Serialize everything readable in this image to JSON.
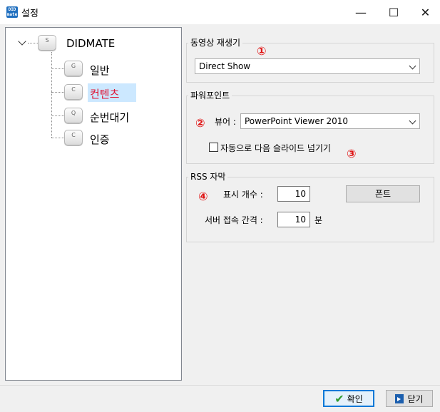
{
  "window": {
    "title": "설정",
    "app_icon_text": "DID mate",
    "minimize_glyph": "—",
    "maximize_glyph": "☐",
    "close_glyph": "✕"
  },
  "tree": {
    "root": {
      "label": "DIDMATE",
      "key": "S",
      "expanded": true
    },
    "children": [
      {
        "label": "일반",
        "key": "G",
        "selected": false
      },
      {
        "label": "컨텐츠",
        "key": "C",
        "selected": true
      },
      {
        "label": "순번대기",
        "key": "Q",
        "selected": false
      },
      {
        "label": "인증",
        "key": "C",
        "selected": false
      }
    ]
  },
  "video_player": {
    "group_title": "동영상 재생기",
    "selected": "Direct Show",
    "badge": "①"
  },
  "powerpoint": {
    "group_title": "파워포인트",
    "viewer_label": "뷰어 :",
    "viewer_selected": "PowerPoint Viewer 2010",
    "auto_next_label": "자동으로 다음 슬라이드 넘기기",
    "auto_next_checked": false,
    "badge_viewer": "②",
    "badge_auto": "③"
  },
  "rss": {
    "group_title": "RSS 자막",
    "count_label": "표시 개수 :",
    "count_value": "10",
    "font_button": "폰트",
    "interval_label": "서버 접속 간격 :",
    "interval_value": "10",
    "interval_unit": "분",
    "badge": "④"
  },
  "footer": {
    "ok_label": "확인",
    "close_label": "닫기"
  },
  "colors": {
    "selected_bg": "#cce8ff",
    "selected_text": "#e0102f",
    "badge": "#e01414",
    "ok_check": "#2f9a2f",
    "close_icon": "#1c5fae"
  }
}
